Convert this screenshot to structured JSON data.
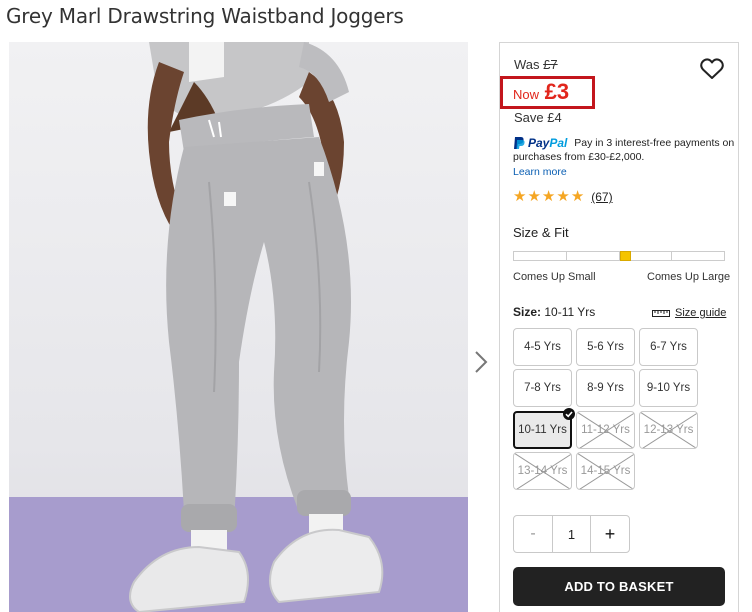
{
  "product": {
    "title": "Grey Marl Drawstring Waistband Joggers"
  },
  "gallery": {
    "image_alt": "Model wearing grey marl joggers and white trainers",
    "next_icon": "chevron-right-icon"
  },
  "pricing": {
    "was_label": "Was",
    "was_price": "£7",
    "now_label": "Now",
    "now_price": "£3",
    "save_label": "Save",
    "save_amount": "£4",
    "highlight_color": "#c3161c"
  },
  "wishlist": {
    "icon": "heart-icon"
  },
  "paypal": {
    "brand_part1": "Pay",
    "brand_part2": "Pal",
    "message": "Pay in 3 interest-free payments on purchases from £30-£2,000.",
    "learn_more": "Learn more"
  },
  "rating": {
    "stars": 5,
    "reviews": "(67)"
  },
  "size_fit": {
    "label": "Size & Fit",
    "left_label": "Comes Up Small",
    "right_label": "Comes Up Large",
    "position": 0.53
  },
  "size": {
    "label": "Size:",
    "selected": "10-11 Yrs",
    "guide_label": "Size guide",
    "options": [
      {
        "label": "4-5 Yrs",
        "state": "available"
      },
      {
        "label": "5-6 Yrs",
        "state": "available"
      },
      {
        "label": "6-7 Yrs",
        "state": "available"
      },
      {
        "label": "7-8 Yrs",
        "state": "available"
      },
      {
        "label": "8-9 Yrs",
        "state": "available"
      },
      {
        "label": "9-10 Yrs",
        "state": "available"
      },
      {
        "label": "10-11 Yrs",
        "state": "selected"
      },
      {
        "label": "11-12 Yrs",
        "state": "out-of-stock"
      },
      {
        "label": "12-13 Yrs",
        "state": "out-of-stock"
      },
      {
        "label": "13-14 Yrs",
        "state": "out-of-stock"
      },
      {
        "label": "14-15 Yrs",
        "state": "out-of-stock"
      }
    ]
  },
  "quantity": {
    "minus": "-",
    "value": "1",
    "plus": "+"
  },
  "cta": {
    "add_to_basket": "ADD TO BASKET"
  }
}
